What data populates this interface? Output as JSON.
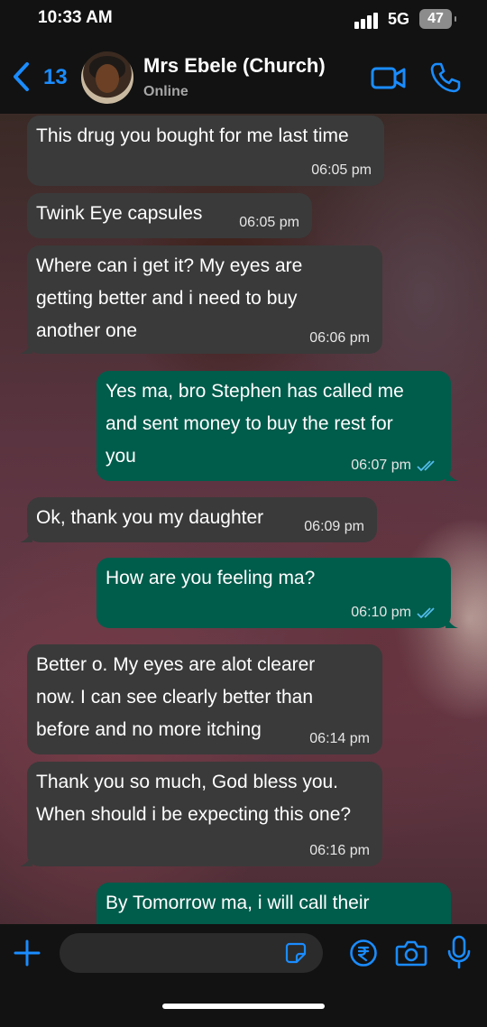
{
  "status_bar": {
    "time": "10:33 AM",
    "network": "5G",
    "battery": "47"
  },
  "header": {
    "back_count": "13",
    "contact_name": "Mrs Ebele (Church)",
    "contact_status": "Online"
  },
  "messages": [
    {
      "direction": "in",
      "text": "This drug you bought for me last time",
      "time": "06:05 pm"
    },
    {
      "direction": "in",
      "text": "Twink Eye capsules",
      "time": "06:05 pm"
    },
    {
      "direction": "in",
      "text": "Where can i get it? My eyes are\ngetting better and i need to buy\nanother one",
      "time": "06:06 pm"
    },
    {
      "direction": "out",
      "text": "Yes ma, bro Stephen has called me\nand sent money to buy the rest for\nyou",
      "time": "06:07 pm",
      "status": "read"
    },
    {
      "direction": "in",
      "text": "Ok, thank you my daughter",
      "time": "06:09 pm"
    },
    {
      "direction": "out",
      "text": "How are you feeling ma?",
      "time": "06:10 pm",
      "status": "read"
    },
    {
      "direction": "in",
      "text": "Better o. My eyes are alot clearer\nnow. I can see clearly better than\nbefore and no more itching",
      "time": "06:14 pm"
    },
    {
      "direction": "in",
      "text": "Thank you so much, God bless you.\nWhen should i be expecting this one?",
      "time": "06:16 pm"
    },
    {
      "direction": "out",
      "text": "By Tomorrow ma, i will call their",
      "time": "",
      "status": ""
    }
  ],
  "composer": {
    "placeholder": ""
  },
  "colors": {
    "accent": "#1a8cff",
    "incoming_bubble": "#3a3a3a",
    "outgoing_bubble": "#005c4b",
    "read_ticks": "#53bdeb"
  },
  "icons": {
    "back": "chevron-left-icon",
    "video": "video-camera-icon",
    "call": "phone-icon",
    "plus": "plus-icon",
    "sticker": "sticker-icon",
    "payment": "rupee-icon",
    "camera": "camera-icon",
    "mic": "microphone-icon"
  }
}
